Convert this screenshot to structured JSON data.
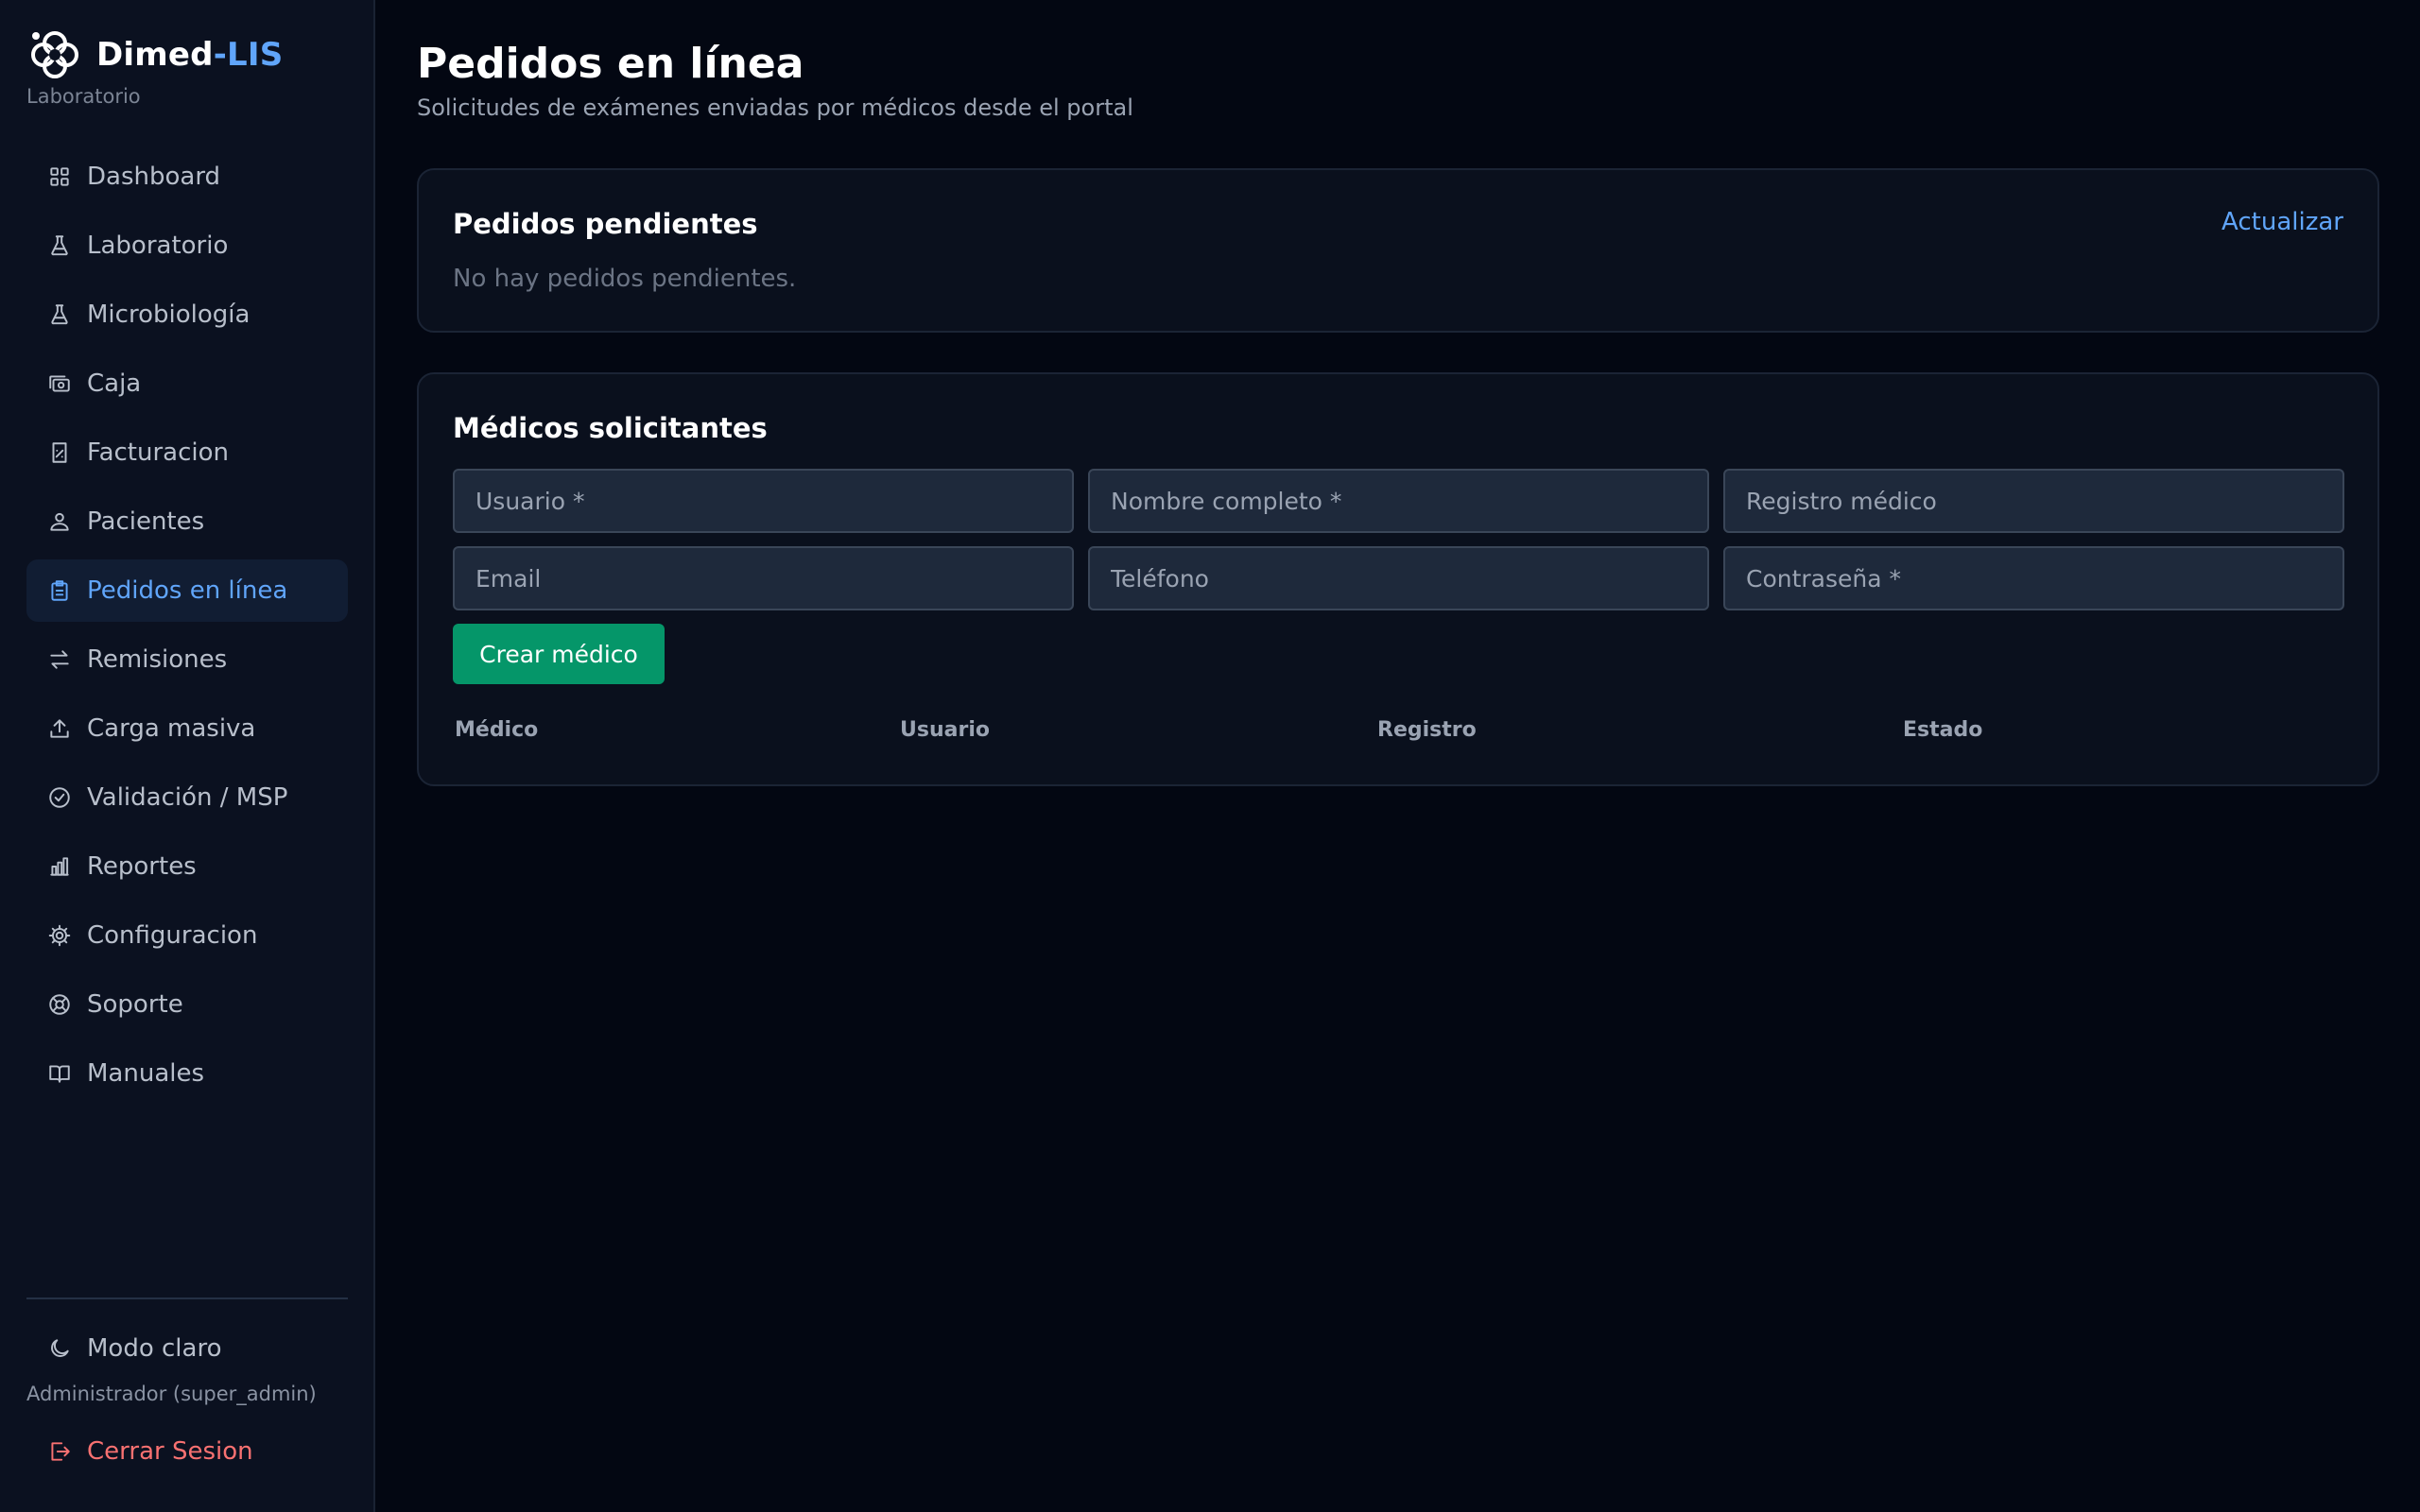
{
  "brand": {
    "name": "Dimed",
    "accent": "-LIS",
    "subtitle": "Laboratorio"
  },
  "sidebar": {
    "items": [
      {
        "label": "Dashboard",
        "icon": "grid-icon"
      },
      {
        "label": "Laboratorio",
        "icon": "flask-icon"
      },
      {
        "label": "Microbiología",
        "icon": "flask-icon"
      },
      {
        "label": "Caja",
        "icon": "cash-icon"
      },
      {
        "label": "Facturacion",
        "icon": "invoice-icon"
      },
      {
        "label": "Pacientes",
        "icon": "patients-icon"
      },
      {
        "label": "Pedidos en línea",
        "icon": "clipboard-icon",
        "active": true
      },
      {
        "label": "Remisiones",
        "icon": "arrows-swap-icon"
      },
      {
        "label": "Carga masiva",
        "icon": "upload-icon"
      },
      {
        "label": "Validación / MSP",
        "icon": "check-circle-icon"
      },
      {
        "label": "Reportes",
        "icon": "bar-chart-icon"
      },
      {
        "label": "Configuracion",
        "icon": "gear-icon"
      },
      {
        "label": "Soporte",
        "icon": "support-icon"
      },
      {
        "label": "Manuales",
        "icon": "book-icon"
      }
    ],
    "theme_toggle": "Modo claro",
    "user": "Administrador (super_admin)",
    "logout": "Cerrar Sesion"
  },
  "page": {
    "title": "Pedidos en línea",
    "subtitle": "Solicitudes de exámenes enviadas por médicos desde el portal"
  },
  "pending": {
    "title": "Pedidos pendientes",
    "refresh": "Actualizar",
    "empty": "No hay pedidos pendientes."
  },
  "doctors": {
    "title": "Médicos solicitantes",
    "fields": {
      "username": {
        "placeholder": "Usuario *",
        "value": ""
      },
      "fullname": {
        "placeholder": "Nombre completo *",
        "value": ""
      },
      "registry": {
        "placeholder": "Registro médico",
        "value": ""
      },
      "email": {
        "placeholder": "Email",
        "value": ""
      },
      "phone": {
        "placeholder": "Teléfono",
        "value": ""
      },
      "password": {
        "placeholder": "Contraseña *",
        "value": ""
      }
    },
    "create_button": "Crear médico",
    "columns": [
      "Médico",
      "Usuario",
      "Registro",
      "Estado"
    ]
  },
  "colors": {
    "background": "#030712",
    "sidebar": "#0b1120",
    "accent": "#60a5fa",
    "active_bg": "#111d33",
    "success": "#059669",
    "danger": "#f87171"
  }
}
